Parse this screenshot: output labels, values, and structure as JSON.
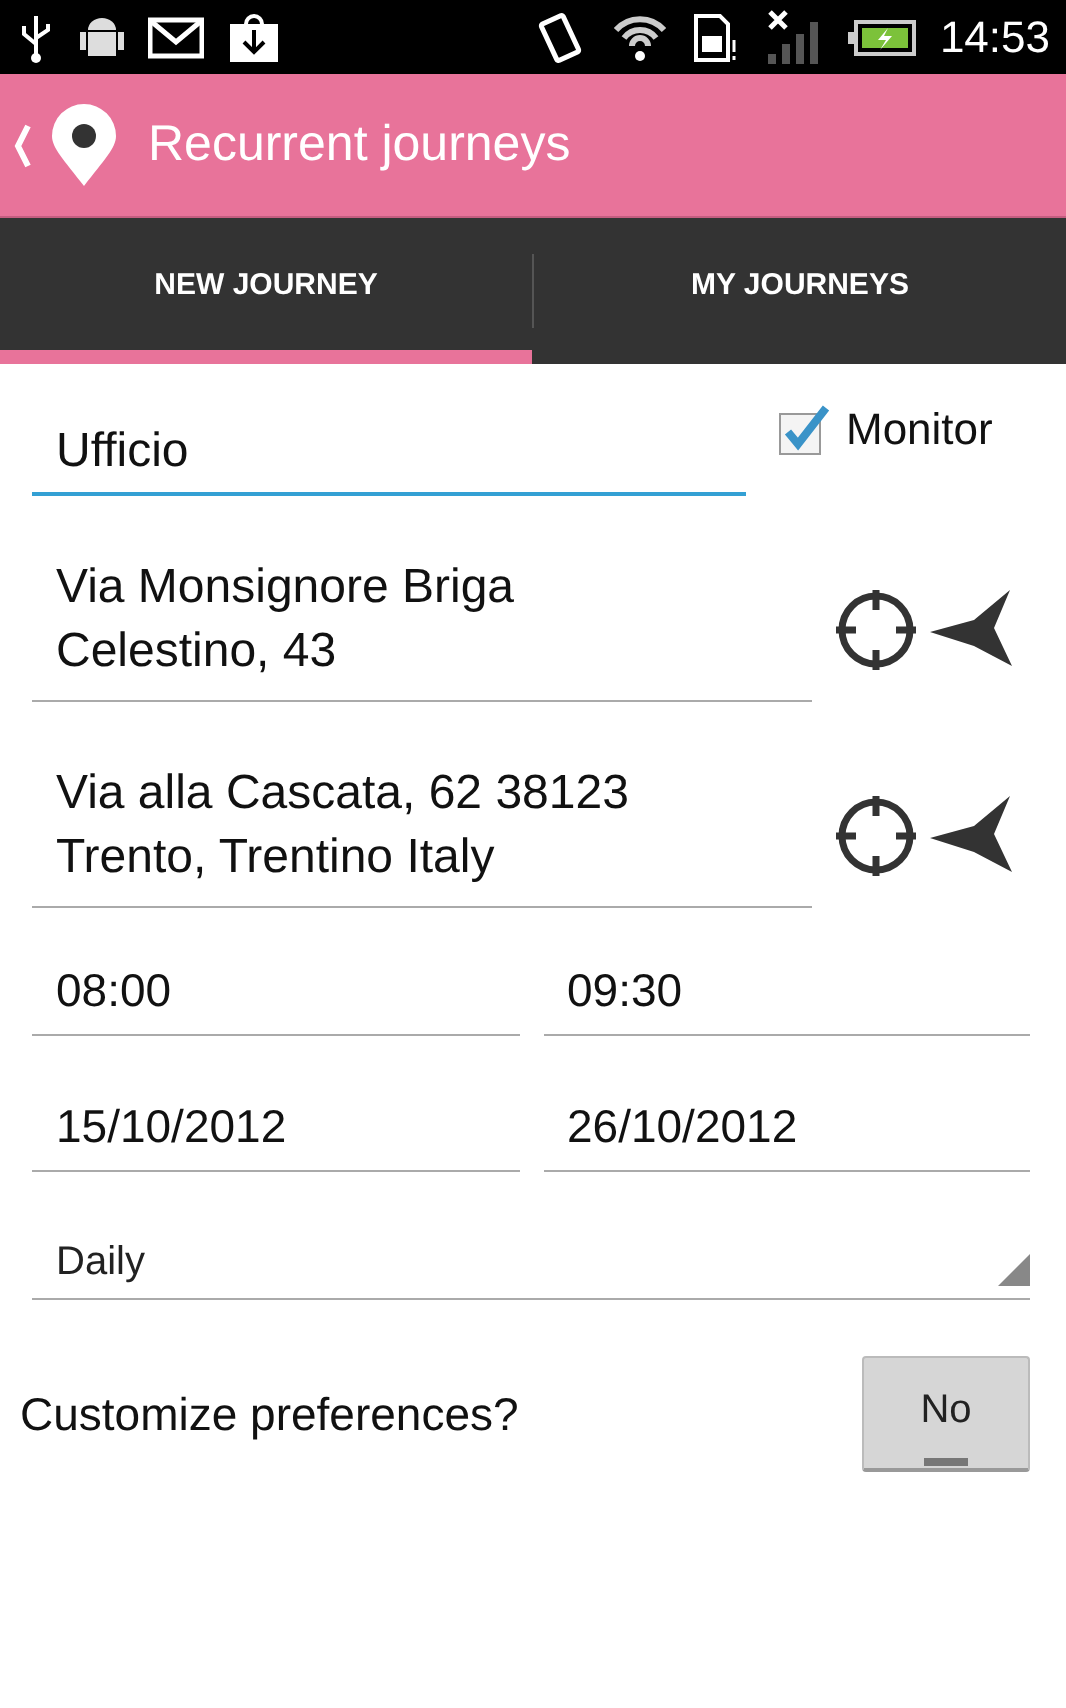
{
  "status_bar": {
    "time": "14:53"
  },
  "action_bar": {
    "title": "Recurrent journeys"
  },
  "tabs": [
    {
      "label": "NEW JOURNEY",
      "selected": true
    },
    {
      "label": "MY JOURNEYS",
      "selected": false
    }
  ],
  "name_field": {
    "value": "Ufficio",
    "focused": true
  },
  "monitor": {
    "label": "Monitor",
    "checked": true
  },
  "addresses": [
    {
      "value": "Via Monsignore Briga Celestino, 43"
    },
    {
      "value": "Via alla Cascata, 62 38123 Trento, Trentino Italy"
    }
  ],
  "times": [
    {
      "value": "08:00"
    },
    {
      "value": "09:30"
    }
  ],
  "dates": [
    {
      "value": "15/10/2012"
    },
    {
      "value": "26/10/2012"
    }
  ],
  "recurrence": {
    "value": "Daily"
  },
  "preferences": {
    "label": "Customize preferences?",
    "toggle": {
      "label": "No",
      "on": false
    }
  }
}
